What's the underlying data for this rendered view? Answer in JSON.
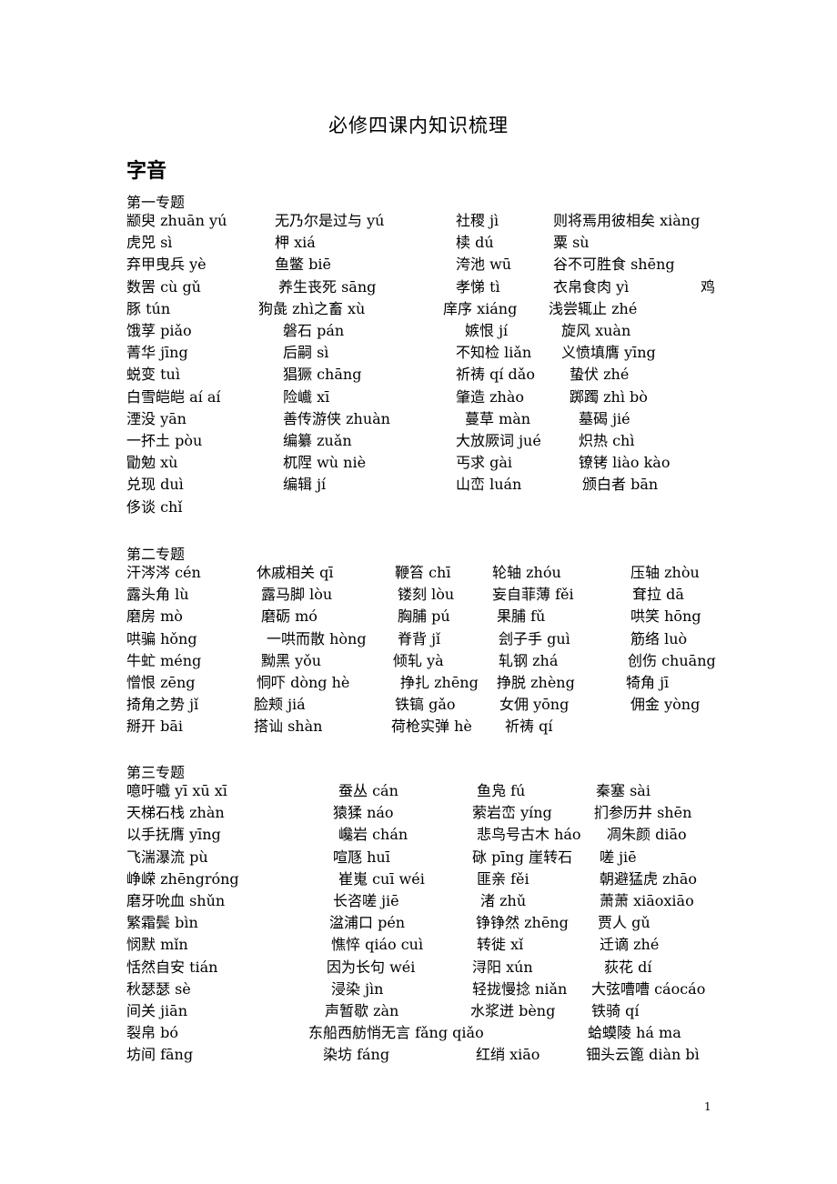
{
  "document": {
    "title": "必修四课内知识梳理",
    "section": "字音",
    "page_number": "1"
  },
  "topics": [
    {
      "title": "第一专题",
      "rows": [
        [
          "颛臾 zhuān  yú",
          "无乃尔是过与 yú",
          "社稷 jì",
          "则将焉用彼相矣 xiàng"
        ],
        [
          "虎兕 sì",
          "柙 xiá",
          "椟 dú",
          "粟 sù"
        ],
        [
          "弃甲曳兵 yè",
          "鱼鳖 biē",
          "洿池 wū",
          "谷不可胜食 shēng"
        ],
        [
          "数罟  cù   gǔ",
          "养生丧死  sāng",
          "孝悌 tì",
          "衣帛食肉 yì",
          "鸡"
        ],
        [
          "豚 tún",
          "狗彘 zhì之畜 xù",
          "庠序 xiáng",
          "浅尝辄止 zhé"
        ],
        [
          "饿莩 piǎo",
          "磐石 pán",
          "嫉恨 jí",
          "旋风 xuàn"
        ],
        [
          "菁华 jīng",
          "后嗣 sì",
          "不知检 liǎn",
          "义愤填膺 yīng"
        ],
        [
          "蜕变 tuì",
          "猖獗 chāng",
          "祈祷 qí  dǎo",
          "蛰伏 zhé"
        ],
        [
          "白雪皑皑 aí  aí",
          "险巇 xī",
          "肇造 zhào",
          "踯躅 zhì  bò"
        ],
        [
          "湮没 yān",
          "善传游侠 zhuàn",
          "蔓草 màn",
          "墓碣 jié"
        ],
        [
          "一抔土 pòu",
          "编纂 zuǎn",
          "大放厥词 jué",
          "炽热 chì"
        ],
        [
          "勖勉 xù",
          "杌陧 wù   niè",
          "丐求 gài",
          "镣铐 liào  kào"
        ],
        [
          "兑现 duì",
          "编辑 jí",
          "山峦  luán",
          "颁白者 bān"
        ],
        [
          "侈谈 chǐ"
        ]
      ]
    },
    {
      "title": "第二专题",
      "rows": [
        [
          "汗涔涔 cén",
          "休戚相关 qī",
          "鞭笞 chī",
          "轮轴 zhóu",
          "压轴 zhòu"
        ],
        [
          "露头角 lù",
          "露马脚 lòu",
          "镂刻 lòu",
          "妄自菲薄 fěi",
          "耷拉 dā"
        ],
        [
          "磨房 mò",
          "磨砺 mó",
          "胸脯 pú",
          "果脯 fǔ",
          "哄笑 hōng"
        ],
        [
          "哄骗 hǒng",
          "一哄而散 hòng",
          "脊背 jǐ",
          "刽子手 guì",
          "筋络 luò"
        ],
        [
          "牛虻 méng",
          "黝黑 yǒu",
          "倾轧 yà",
          "轧钢 zhá",
          "创伤 chuāng"
        ],
        [
          "憎恨 zēng",
          "恫吓 dòng hè",
          "挣扎 zhēng",
          "挣脱 zhèng",
          "犄角 jī"
        ],
        [
          "掎角之势 jǐ",
          "脸颊 jiá",
          "铁镐 gǎo",
          "女佣 yōng",
          "佣金 yòng"
        ],
        [
          "掰开 bāi",
          "搭讪 shàn",
          "荷枪实弹 hè",
          "祈祷 qí"
        ]
      ]
    },
    {
      "title": "第三专题",
      "rows": [
        [
          "噫吁嚱  yī  xū  xī",
          "蚕丛 cán",
          "鱼凫 fú",
          "秦塞 sài"
        ],
        [
          "天梯石栈 zhàn",
          "猿猱 náo",
          "萦岩峦 yíng",
          "扪参历井 shēn"
        ],
        [
          "以手抚膺 yīng",
          "巉岩 chán",
          "悲鸟号古木 háo",
          "凋朱颜 diāo"
        ],
        [
          "飞湍瀑流 pù",
          "喧豗 huī",
          "砯 pīng 崖转石",
          "嗟 jiē"
        ],
        [
          "峥嵘 zhēngróng",
          "崔嵬 cuī  wéi",
          "匪亲 fěi",
          "朝避猛虎 zhāo"
        ],
        [
          "磨牙吮血 shǔn",
          "长咨嗟 jiē",
          "渚 zhǔ",
          "萧萧 xiāoxiāo"
        ],
        [
          "繁霜鬓 bìn",
          "湓浦口 pén",
          "铮铮然 zhēng",
          "贾人 gǔ"
        ],
        [
          "悯默 mǐn",
          "憔悴 qiáo cuì",
          "转徙 xǐ",
          "迁谪 zhé"
        ],
        [
          "恬然自安 tián",
          "因为长句 wéi",
          "浔阳 xún",
          "荻花 dí"
        ],
        [
          "秋瑟瑟 sè",
          "浸染 jìn",
          "轻拢慢捻 niǎn",
          "大弦嘈嘈 cáocáo"
        ],
        [
          "间关 jiān",
          "声暂歇 zàn",
          "水浆迸 bèng",
          "铁骑 qí"
        ],
        [
          "裂帛 bó",
          "东船西舫悄无言 fǎng qiǎo",
          "蛤蟆陵 há  ma"
        ],
        [
          "坊间 fāng",
          "染坊 fáng",
          "红绡 xiāo",
          "钿头云篦 diàn bì"
        ]
      ]
    }
  ]
}
